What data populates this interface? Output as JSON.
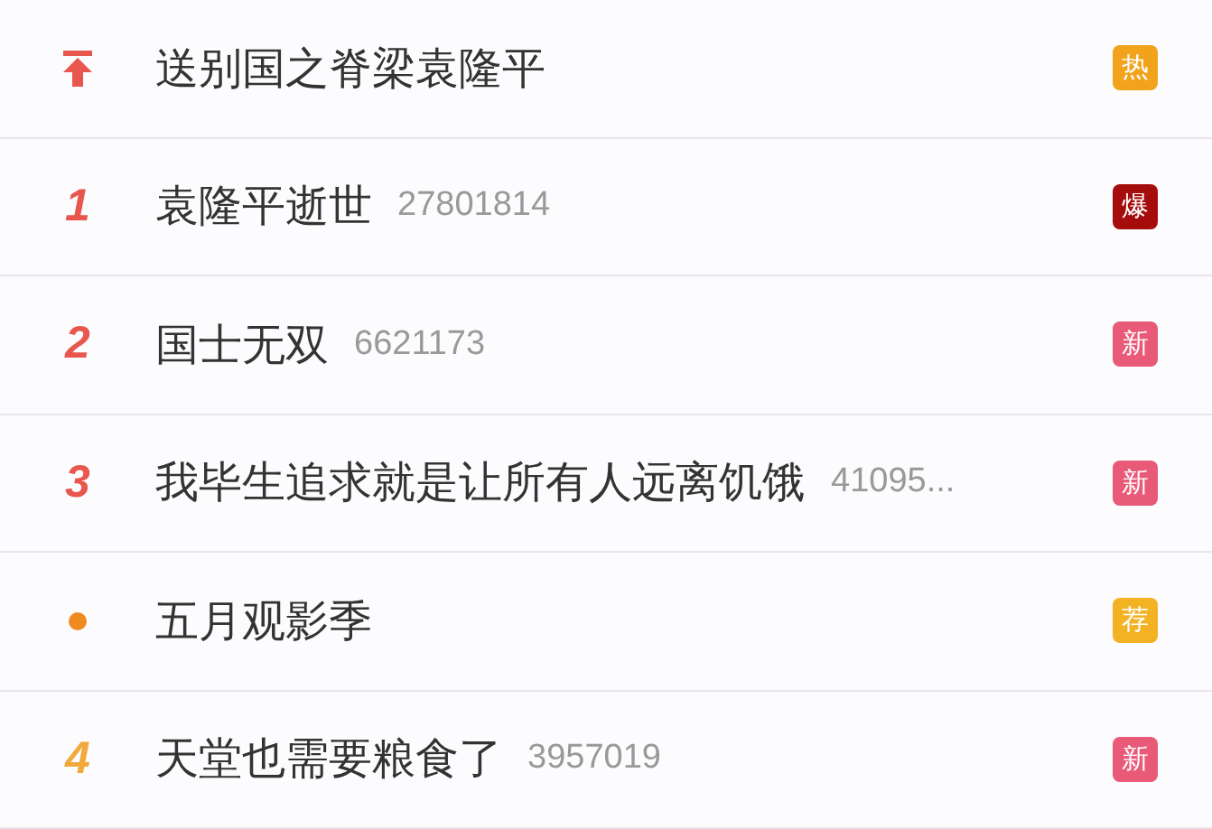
{
  "hot_list": [
    {
      "kind": "pin",
      "color": "#e8574e",
      "title": "送别国之脊梁袁隆平",
      "badge": {
        "text": "热",
        "color": "#f2a31c"
      }
    },
    {
      "kind": "number",
      "rank": "1",
      "color": "#e8574e",
      "title": "袁隆平逝世",
      "count": "27801814",
      "badge": {
        "text": "爆",
        "color": "#a50d0d"
      }
    },
    {
      "kind": "number",
      "rank": "2",
      "color": "#e8574e",
      "title": "国士无双",
      "count": "6621173",
      "badge": {
        "text": "新",
        "color": "#e85a78"
      }
    },
    {
      "kind": "number",
      "rank": "3",
      "color": "#e8574e",
      "title": "我毕生追求就是让所有人远离饥饿",
      "count": "41095...",
      "badge": {
        "text": "新",
        "color": "#e85a78"
      }
    },
    {
      "kind": "dot",
      "color": "#f0891e",
      "title": "五月观影季",
      "badge": {
        "text": "荐",
        "color": "#f2b224"
      }
    },
    {
      "kind": "number",
      "rank": "4",
      "color": "#f2a93b",
      "title": "天堂也需要粮食了",
      "count": "3957019",
      "badge": {
        "text": "新",
        "color": "#e85a78"
      }
    }
  ]
}
